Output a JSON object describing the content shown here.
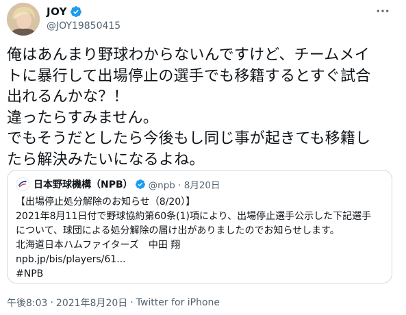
{
  "author": {
    "display_name": "JOY",
    "handle": "@JOY19850415",
    "verified_icon": "verified-badge-icon",
    "more_icon": "more-horizontal-icon"
  },
  "tweet": {
    "lines": [
      "俺はあんまり野球わからないんですけど、チームメイ",
      "トに暴行して出場停止の選手でも移籍するとすぐ試合",
      "出れるんかな？！",
      "違ったらすみません。",
      "でもそうだとしたら今後もし同じ事が起きても移籍し",
      "たら解決みたいになるよね。"
    ]
  },
  "quoted": {
    "display_name": "日本野球機構（NPB）",
    "handle_date": "@npb · 8月20日",
    "avatar_icon": "npb-logo-icon",
    "lines": [
      "【出場停止処分解除のお知らせ（8/20）】",
      "2021年8月11日付で野球協約第60条(1)項により、出場停止選手公示した下記選手",
      "について、球団による処分解除の届け出がありましたのでお知らせします。",
      "北海道日本ハムファイターズ　中田 翔",
      "npb.jp/bis/players/61...",
      "#NPB"
    ]
  },
  "footer": {
    "time": "午後8:03",
    "separator1": "·",
    "date": "2021年8月20日",
    "separator2": "·",
    "source": "Twitter for iPhone"
  },
  "colors": {
    "text": "#0f1419",
    "secondary": "#536471",
    "verified": "#1d9bf0",
    "border": "#cfd9de"
  }
}
